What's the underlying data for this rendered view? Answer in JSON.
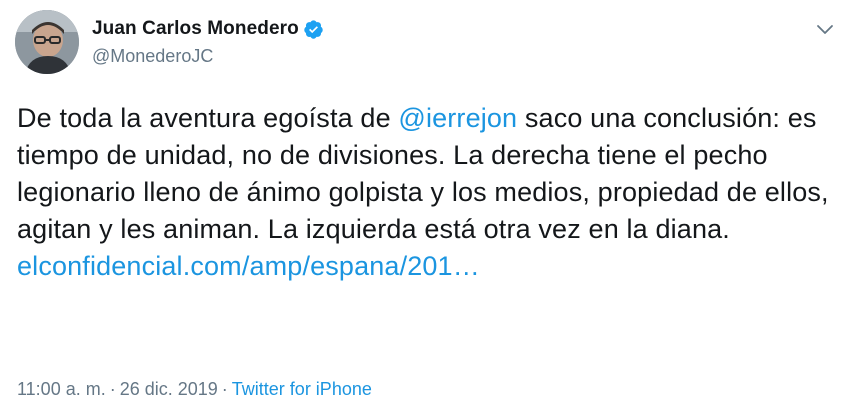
{
  "author": {
    "name": "Juan Carlos Monedero",
    "handle": "@MonederoJC",
    "avatar_icon": "user-avatar",
    "verified_icon": "verified-badge-icon"
  },
  "menu_icon": "chevron-down-icon",
  "tweet": {
    "text_1": "De toda la aventura egoísta de ",
    "mention": "@ierrejon",
    "text_2": " saco una conclusión: es tiempo de unidad, no de divisiones. La derecha tiene el pecho legionario lleno de ánimo golpista y los medios, propiedad de ellos, agitan y les animan. La izquierda está otra vez en la diana. ",
    "link": "elconfidencial.com/amp/espana/201…"
  },
  "meta": {
    "time": "11:00 a. m.",
    "separator": "·",
    "date": "26 dic. 2019",
    "source": "Twitter for iPhone"
  },
  "colors": {
    "link": "#1b95e0",
    "text": "#14171a",
    "muted": "#657786"
  }
}
